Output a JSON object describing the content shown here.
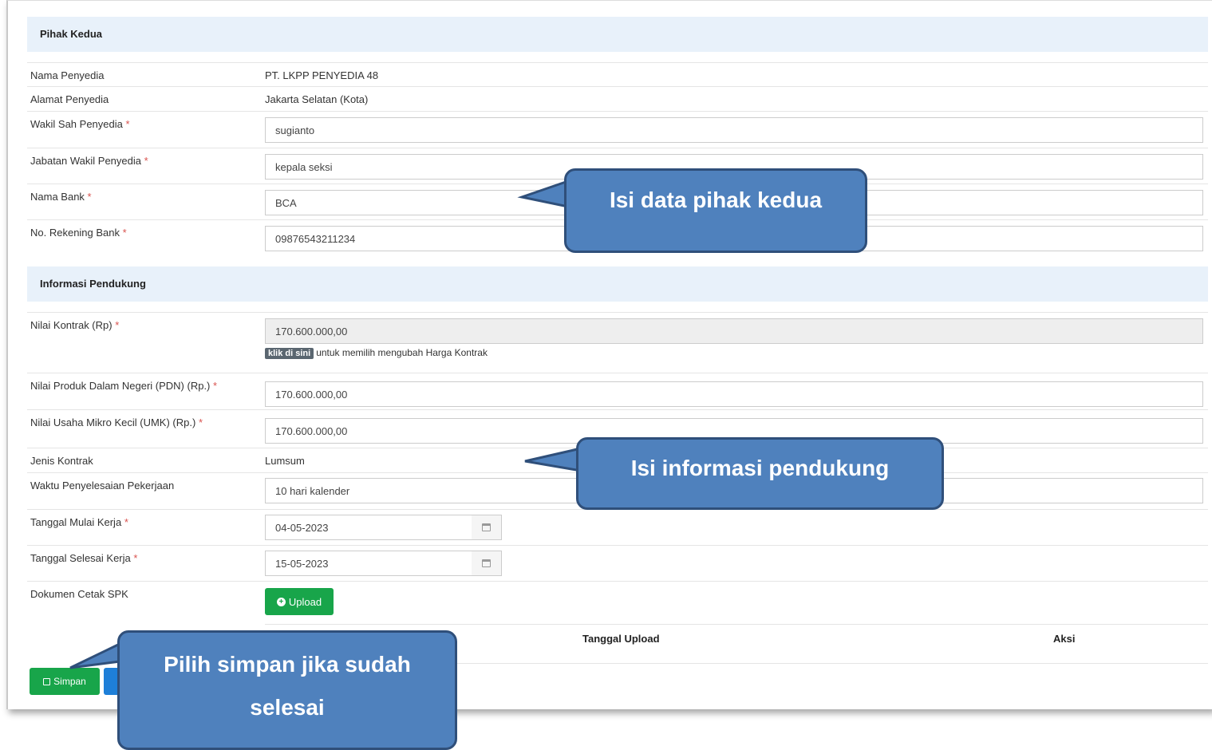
{
  "pihak_kedua": {
    "title": "Pihak Kedua",
    "nama_penyedia": {
      "label": "Nama Penyedia",
      "value": "PT. LKPP PENYEDIA 48"
    },
    "alamat_penyedia": {
      "label": "Alamat Penyedia",
      "value": "Jakarta Selatan (Kota)"
    },
    "wakil_sah": {
      "label": "Wakil Sah Penyedia",
      "value": "sugianto"
    },
    "jabatan_wakil": {
      "label": "Jabatan Wakil Penyedia",
      "value": "kepala seksi"
    },
    "nama_bank": {
      "label": "Nama Bank",
      "value": "BCA"
    },
    "no_rekening": {
      "label": "No. Rekening Bank",
      "value": "09876543211234"
    }
  },
  "informasi_pendukung": {
    "title": "Informasi Pendukung",
    "nilai_kontrak": {
      "label": "Nilai Kontrak (Rp)",
      "value": "170.600.000,00",
      "hint_badge": "klik di sini",
      "hint_text": "untuk memilih mengubah Harga Kontrak"
    },
    "nilai_pdn": {
      "label": "Nilai Produk Dalam Negeri (PDN) (Rp.)",
      "value": "170.600.000,00"
    },
    "nilai_umk": {
      "label": "Nilai Usaha Mikro Kecil (UMK) (Rp.)",
      "value": "170.600.000,00"
    },
    "jenis_kontrak": {
      "label": "Jenis Kontrak",
      "value": "Lumsum"
    },
    "waktu_penyelesaian": {
      "label": "Waktu Penyelesaian Pekerjaan",
      "value": "10 hari kalender"
    },
    "tanggal_mulai": {
      "label": "Tanggal Mulai Kerja",
      "value": "04-05-2023"
    },
    "tanggal_selesai": {
      "label": "Tanggal Selesai Kerja",
      "value": "15-05-2023"
    },
    "dokumen_spk": {
      "label": "Dokumen Cetak SPK",
      "upload_label": "Upload"
    }
  },
  "doc_table": {
    "col_tanggal": "Tanggal Upload",
    "col_aksi": "Aksi"
  },
  "actions": {
    "simpan_label": "Simpan"
  },
  "required_mark": "*",
  "callouts": {
    "pihak_kedua": "Isi data pihak kedua",
    "informasi": "Isi informasi pendukung",
    "simpan_line1": "Pilih simpan jika sudah",
    "simpan_line2": "selesai"
  },
  "colors": {
    "section_bg": "#e8f1fa",
    "success": "#18a54a",
    "primary": "#1e7fd8",
    "callout_fill": "#4f81bd",
    "callout_border": "#2f4f7a"
  }
}
